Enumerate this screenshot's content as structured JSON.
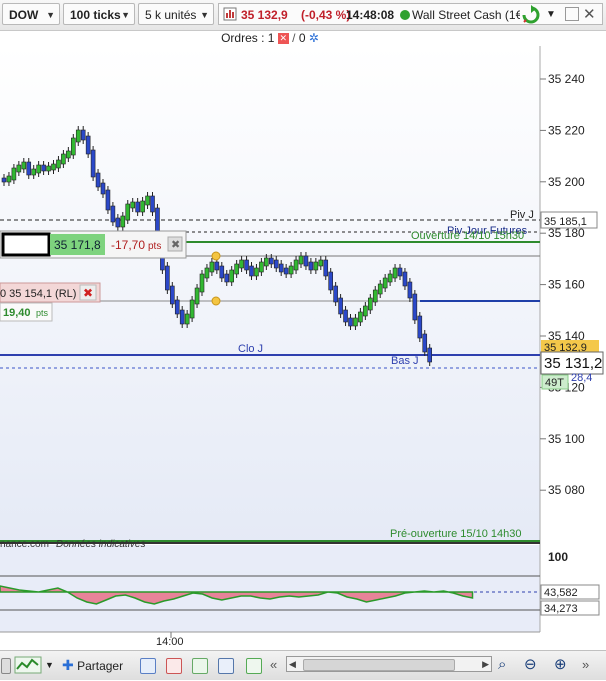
{
  "toolbar": {
    "instrument": "DOW",
    "ticks": "100 ticks",
    "units": "5 k unités",
    "price": "35 132,9",
    "change": "(-0,43 %)",
    "time": "14:48:08",
    "instrument_name": "Wall Street Cash (1€"
  },
  "orders": {
    "label": "Ordres :",
    "count1": "1",
    "count2": "0"
  },
  "colors": {
    "up": "#32b832",
    "down": "#2b48c9",
    "neutral": "#222",
    "grid": "#c9d6e6",
    "bg_top": "#ffffff",
    "bg_bottom": "#e7ecf6"
  },
  "price_axis": {
    "labels": [
      "35 240",
      "35 220",
      "35 200",
      "35 180",
      "35 160",
      "35 140",
      "35 120",
      "35 100",
      "35 080"
    ],
    "current_box": "35 132,9",
    "crosshair_box_main": "35 131,2",
    "crosshair_box_sub": "49T",
    "crosshair_box_sub2": "28,4",
    "piv_value": "35 185,1"
  },
  "levels": {
    "piv_j": "Piv J",
    "piv_jour_futures": "Piv Jour Futures",
    "ouverture": "Ouverture 14/10 15h30",
    "clo_j": "Clo J",
    "bas_j": "Bas J",
    "preouverture": "Pré-ouverture 15/10 14h30"
  },
  "order_widgets": {
    "price1": "35 171,8",
    "pts1": "-17,70",
    "pts_unit": "pts",
    "order2": "0 35 154,1 (RL)",
    "pts2": "19,40"
  },
  "source": "nance.com",
  "disclaimer": "Données indicatives",
  "oscillator": {
    "label_top": "100",
    "value1": "43,582",
    "value2": "34,273"
  },
  "time_axis": {
    "label": "14:00"
  },
  "bottom": {
    "share": "Partager"
  }
}
